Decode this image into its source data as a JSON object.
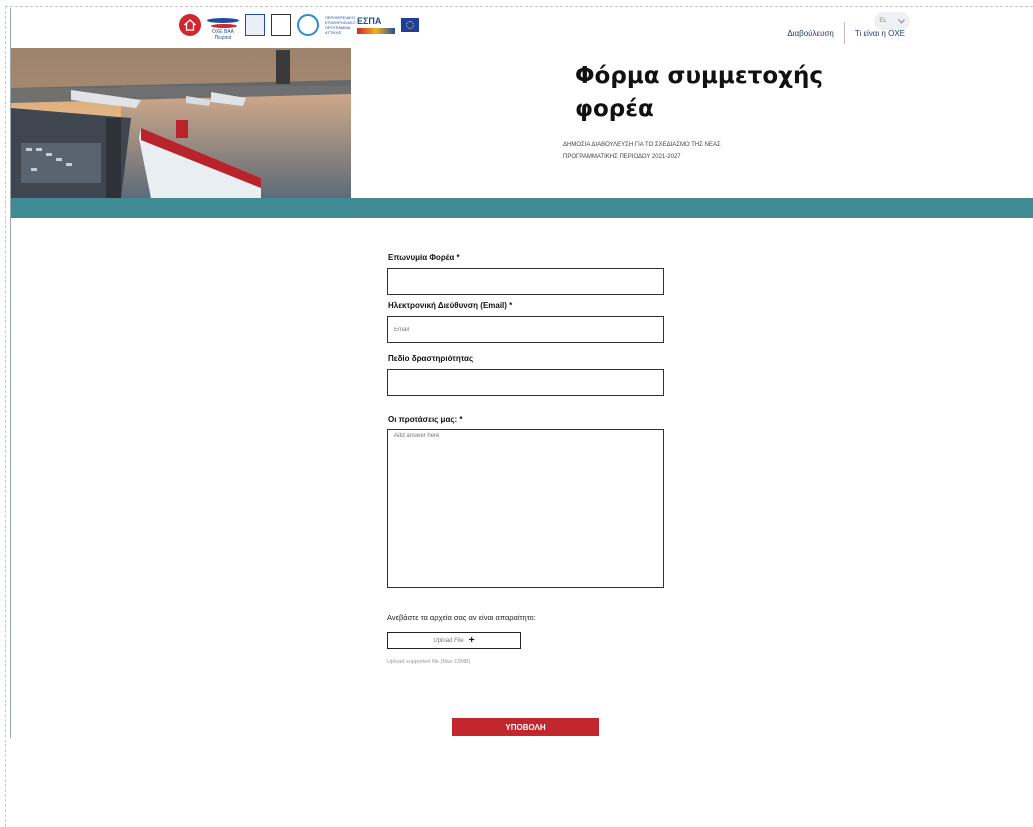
{
  "header": {
    "logos": {
      "ship_text": "ΟΧΕ ΒΑΑ Πειραιά",
      "program_text": "ΠΕΡΙΦΕΡΕΙΑΚΟ ΕΠΙΧΕΙΡΗΣΙΑΚΟ ΠΡΟΓΡΑΜΜΑ ΑΤΤΙΚΗΣ",
      "espa_text": "ΕΣΠΑ",
      "espa_years": "2014-2020"
    },
    "nav": [
      "Διαβούλευση",
      "Τι είναι η ΟΧΕ"
    ],
    "lang": {
      "value": "EL",
      "chevron": "chevron-down-icon"
    }
  },
  "hero": {
    "title_line1": "Φόρμα συμμετοχής",
    "title_line2": "φορέα",
    "subtitle_line1": "ΔΗΜΟΣΙΑ ΔΙΑΒΟΥΛΕΥΣΗ ΓΙΑ ΤΟ ΣΧΕΔΙΑΣΜΟ ΤΗΣ ΝΕΑΣ",
    "subtitle_line2": "ΠΡΟΓΡΑΜΜΑΤΙΚΗΣ ΠΕΡΙΟΔΟΥ 2021-2027",
    "band_color": "#3f8a95"
  },
  "form": {
    "org_name_label": "Επωνυμία Φορέα *",
    "org_name_value": "",
    "email_label": "Ηλεκτρονική Διεύθυνση (Email) *",
    "email_placeholder": "Email",
    "field_label": "Πεδίο δραστηριότητας",
    "field_value": "",
    "proposals_label": "Οι προτάσεις μας: *",
    "proposals_placeholder": "Add answer here",
    "upload_label": "Ανεβάστε τα αρχεία σας αν είναι απαραίτητο:",
    "upload_button": "Upload File",
    "upload_note": "Upload supported file (Max 15MB)",
    "submit_label": "ΥΠΟΒΟΛΗ",
    "submit_color": "#c1272d"
  }
}
